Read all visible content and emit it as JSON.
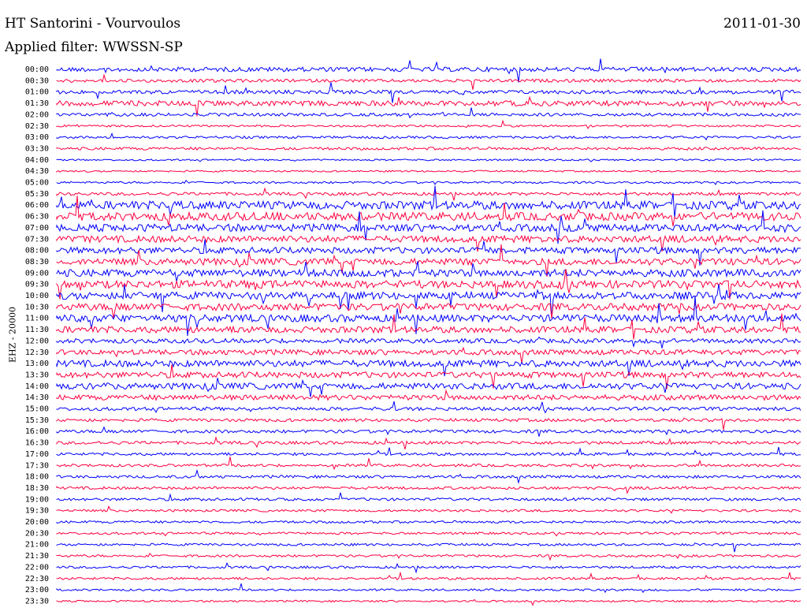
{
  "header": {
    "title": "HT Santorini - Vourvoulos",
    "date": "2011-01-30",
    "filter": "Applied filter: WWSSN-SP"
  },
  "chart_data": {
    "type": "line",
    "description_text": "helicorder",
    "channel_label": "EHZ - 20000",
    "series_colors": [
      "#0000ff",
      "#ff0040"
    ],
    "rows": [
      {
        "label": "00:00",
        "activity": 0.5
      },
      {
        "label": "00:30",
        "activity": 0.3
      },
      {
        "label": "01:00",
        "activity": 0.4
      },
      {
        "label": "01:30",
        "activity": 0.6
      },
      {
        "label": "02:00",
        "activity": 0.3
      },
      {
        "label": "02:30",
        "activity": 0.15
      },
      {
        "label": "03:00",
        "activity": 0.2
      },
      {
        "label": "03:30",
        "activity": 0.25
      },
      {
        "label": "04:00",
        "activity": 0.1
      },
      {
        "label": "04:30",
        "activity": 0.1
      },
      {
        "label": "05:00",
        "activity": 0.15
      },
      {
        "label": "05:30",
        "activity": 0.3
      },
      {
        "label": "06:00",
        "activity": 1.0
      },
      {
        "label": "06:30",
        "activity": 1.0
      },
      {
        "label": "07:00",
        "activity": 0.9
      },
      {
        "label": "07:30",
        "activity": 0.8
      },
      {
        "label": "08:00",
        "activity": 0.75
      },
      {
        "label": "08:30",
        "activity": 0.8
      },
      {
        "label": "09:00",
        "activity": 0.9
      },
      {
        "label": "09:30",
        "activity": 0.95
      },
      {
        "label": "10:00",
        "activity": 0.9
      },
      {
        "label": "10:30",
        "activity": 0.85
      },
      {
        "label": "11:00",
        "activity": 0.9
      },
      {
        "label": "11:30",
        "activity": 0.75
      },
      {
        "label": "12:00",
        "activity": 0.5
      },
      {
        "label": "12:30",
        "activity": 0.6
      },
      {
        "label": "13:00",
        "activity": 0.8
      },
      {
        "label": "13:30",
        "activity": 0.7
      },
      {
        "label": "14:00",
        "activity": 0.75
      },
      {
        "label": "14:30",
        "activity": 0.6
      },
      {
        "label": "15:00",
        "activity": 0.35
      },
      {
        "label": "15:30",
        "activity": 0.3
      },
      {
        "label": "16:00",
        "activity": 0.3
      },
      {
        "label": "16:30",
        "activity": 0.3
      },
      {
        "label": "17:00",
        "activity": 0.25
      },
      {
        "label": "17:30",
        "activity": 0.25
      },
      {
        "label": "18:00",
        "activity": 0.25
      },
      {
        "label": "18:30",
        "activity": 0.25
      },
      {
        "label": "19:00",
        "activity": 0.25
      },
      {
        "label": "19:30",
        "activity": 0.2
      },
      {
        "label": "20:00",
        "activity": 0.2
      },
      {
        "label": "20:30",
        "activity": 0.2
      },
      {
        "label": "21:00",
        "activity": 0.2
      },
      {
        "label": "21:30",
        "activity": 0.2
      },
      {
        "label": "22:00",
        "activity": 0.2
      },
      {
        "label": "22:30",
        "activity": 0.2
      },
      {
        "label": "23:00",
        "activity": 0.15
      },
      {
        "label": "23:30",
        "activity": 0.12
      }
    ]
  }
}
